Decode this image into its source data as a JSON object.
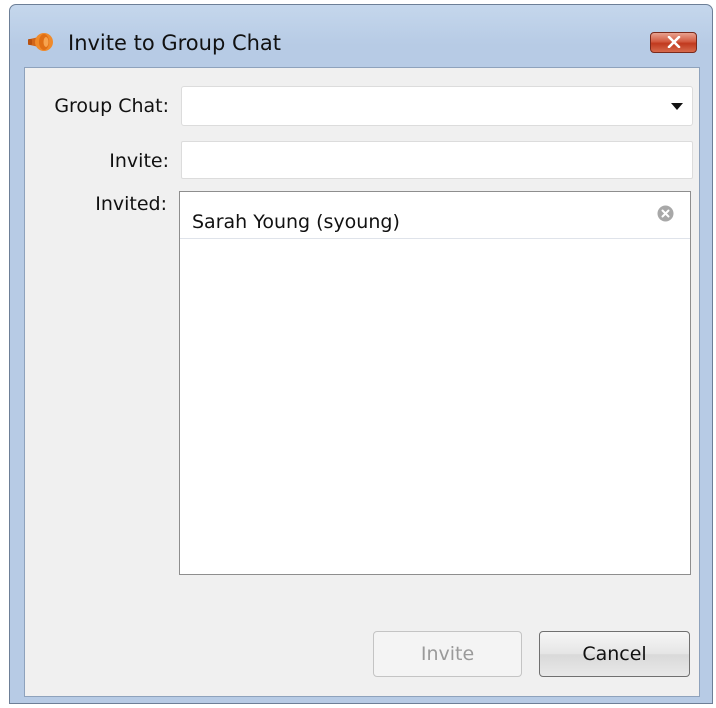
{
  "window": {
    "title": "Invite to Group Chat"
  },
  "form": {
    "group_chat_label": "Group Chat:",
    "group_chat_value": "",
    "invite_label": "Invite:",
    "invite_value": "",
    "invited_label": "Invited:",
    "invited_list": [
      {
        "name": "Sarah Young (syoung)"
      }
    ]
  },
  "buttons": {
    "invite_label": "Invite",
    "invite_enabled": false,
    "cancel_label": "Cancel"
  },
  "icons": {
    "app": "megaphone-icon",
    "close": "close-icon",
    "remove": "remove-circle-icon",
    "dropdown": "chevron-down-icon"
  },
  "colors": {
    "app_icon": "#e8741c",
    "close_button": "#c8442a",
    "titlebar": "#b9cde6"
  }
}
